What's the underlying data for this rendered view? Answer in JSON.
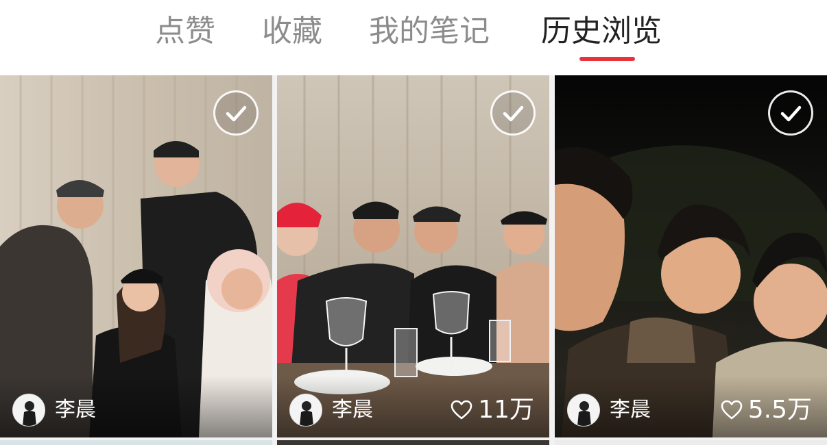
{
  "tabs": [
    {
      "label": "点赞",
      "active": false
    },
    {
      "label": "收藏",
      "active": false
    },
    {
      "label": "我的笔记",
      "active": false
    },
    {
      "label": "历史浏览",
      "active": true
    }
  ],
  "accent_color": "#e8323c",
  "icons": {
    "check": "check-circle-icon",
    "like": "heart-outline-icon"
  },
  "cards": [
    {
      "author": "李晨",
      "likes": "",
      "selected": true
    },
    {
      "author": "李晨",
      "likes": "11万",
      "selected": true
    },
    {
      "author": "李晨",
      "likes": "5.5万",
      "selected": true
    }
  ]
}
